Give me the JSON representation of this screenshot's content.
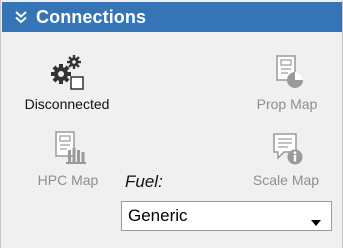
{
  "header": {
    "title": "Connections",
    "collapse_icon": "double-chevron-down-icon"
  },
  "tools": {
    "disconnected": {
      "label": "Disconnected",
      "icon": "gears-icon",
      "enabled": true
    },
    "prop_map": {
      "label": "Prop Map",
      "icon": "prop-map-icon",
      "enabled": false
    },
    "hpc_map": {
      "label": "HPC Map",
      "icon": "hpc-map-icon",
      "enabled": false
    },
    "scale_map": {
      "label": "Scale Map",
      "icon": "scale-map-icon",
      "enabled": false
    }
  },
  "fuel": {
    "label": "Fuel:",
    "selected": "Generic"
  },
  "colors": {
    "header_bg": "#3674b8",
    "header_text": "#ffffff",
    "disabled_text": "#8e8e8e",
    "panel_bg": "#f0f0f0"
  }
}
